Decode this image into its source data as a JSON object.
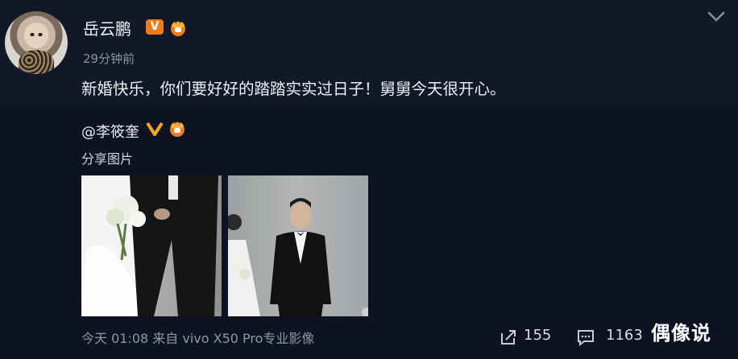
{
  "post": {
    "username": "岳云鹏",
    "verified_badge": "V",
    "timestamp": "29分钟前",
    "text": "新婚快乐，你们要好好的踏踏实实过日子！舅舅今天很开心。"
  },
  "repost": {
    "author": "@李筱奎",
    "subtitle": "分享图片"
  },
  "footer": {
    "meta": "今天 01:08 来自 vivo X50 Pro专业影像",
    "share_count": "155",
    "comment_count": "1163"
  },
  "watermark": "偶像说",
  "icons": [
    "chevron-down-icon",
    "vip-crown-icon",
    "share-icon",
    "comment-icon"
  ],
  "colors": {
    "accent": "#f07b1f",
    "background": "#0e1424"
  }
}
